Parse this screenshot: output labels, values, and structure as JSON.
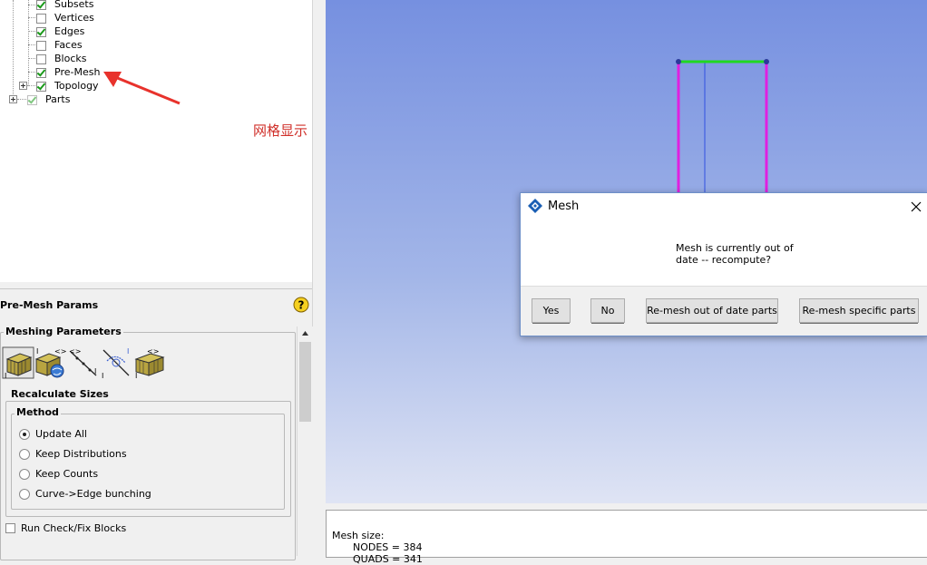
{
  "tree": {
    "items": [
      {
        "label": "Subsets",
        "checked": true
      },
      {
        "label": "Vertices",
        "checked": false
      },
      {
        "label": "Edges",
        "checked": true
      },
      {
        "label": "Faces",
        "checked": false
      },
      {
        "label": "Blocks",
        "checked": false
      },
      {
        "label": "Pre-Mesh",
        "checked": true
      },
      {
        "label": "Topology",
        "checked": true
      },
      {
        "label": "Parts",
        "checked": true
      }
    ]
  },
  "annotation": {
    "note": "网格显示",
    "arrow_color": "#e8322c"
  },
  "params": {
    "title": "Pre-Mesh Params",
    "meshing_parameters_label": "Meshing Parameters",
    "recalculate_sizes_label": "Recalculate Sizes",
    "method_label": "Method",
    "method_options": [
      {
        "label": "Update All",
        "selected": true
      },
      {
        "label": "Keep Distributions",
        "selected": false
      },
      {
        "label": "Keep Counts",
        "selected": false
      },
      {
        "label": "Curve->Edge bunching",
        "selected": false
      }
    ],
    "run_check_label": "Run Check/Fix Blocks",
    "tool_icons": [
      "premesh-params-block-icon",
      "scan-sizes-icon",
      "edge-params-icon",
      "match-edges-icon",
      "refinement-icon"
    ]
  },
  "dialog": {
    "title": "Mesh",
    "message_line1": "Mesh is currently out of",
    "message_line2": "date -- recompute?",
    "buttons": {
      "yes": "Yes",
      "no": "No",
      "remesh_out_of_date": "Re-mesh out of date parts",
      "remesh_specific": "Re-mesh specific parts"
    }
  },
  "console": {
    "line1": "Mesh size:",
    "line2": "NODES = 384",
    "line3": "QUADS = 341"
  },
  "colors": {
    "edge_vertical": "#e020e0",
    "edge_top": "#20d820",
    "inner_line": "#3050e0",
    "vertex": "#2a3a9a"
  }
}
